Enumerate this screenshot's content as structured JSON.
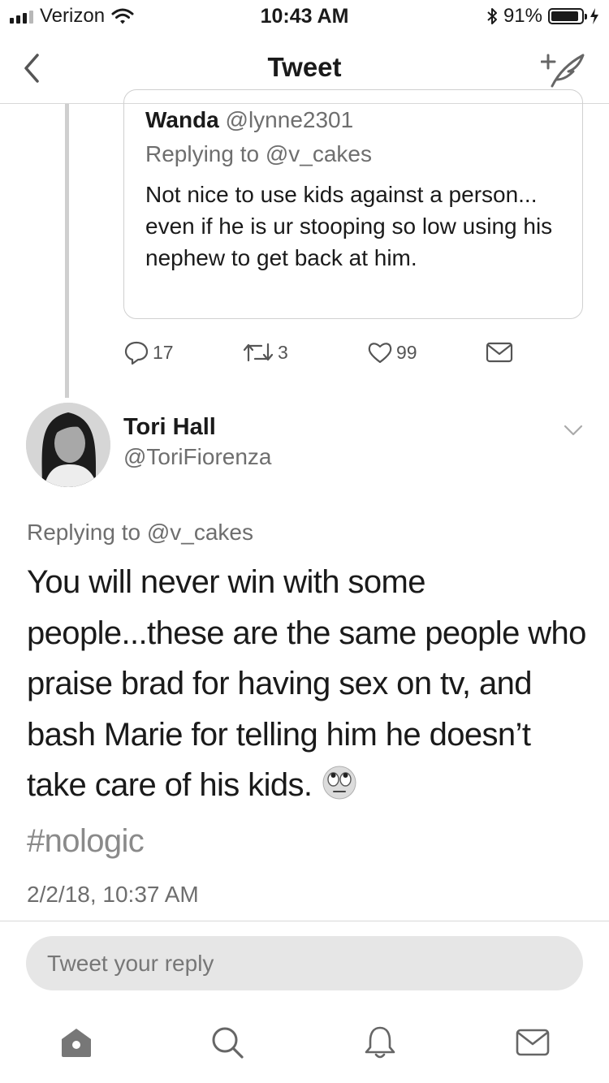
{
  "status": {
    "carrier": "Verizon",
    "time": "10:43 AM",
    "battery": "91%",
    "battery_level": 0.91
  },
  "nav": {
    "title": "Tweet",
    "back_icon": "chevron-left-icon",
    "compose_icon": "compose-tweet-icon"
  },
  "quoted": {
    "name": "Wanda",
    "handle": "@lynne2301",
    "replying": "Replying to @v_cakes",
    "text": "Not nice to use kids against a person... even if he is ur stooping so low using his nephew to get back at him.",
    "replies": "17",
    "retweets": "3",
    "likes": "99"
  },
  "main": {
    "name": "Tori Hall",
    "handle": "@ToriFiorenza",
    "replying": "Replying to @v_cakes",
    "text": "You will never win with some people...these are the same people who praise brad for having sex on tv, and bash Marie for telling him he doesn’t take care of his kids.",
    "emoji": "face-with-rolling-eyes",
    "hashtag": "#nologic",
    "timestamp": "2/2/18, 10:37 AM"
  },
  "reply": {
    "placeholder": "Tweet your reply"
  },
  "tabs": [
    "home-icon",
    "search-icon",
    "notifications-bell-icon",
    "messages-envelope-icon"
  ],
  "colors": {
    "text": "#1a1a1a",
    "secondary": "#6e6e6e",
    "hashtag": "#8a8a8a",
    "divider": "#d8d8d8"
  }
}
